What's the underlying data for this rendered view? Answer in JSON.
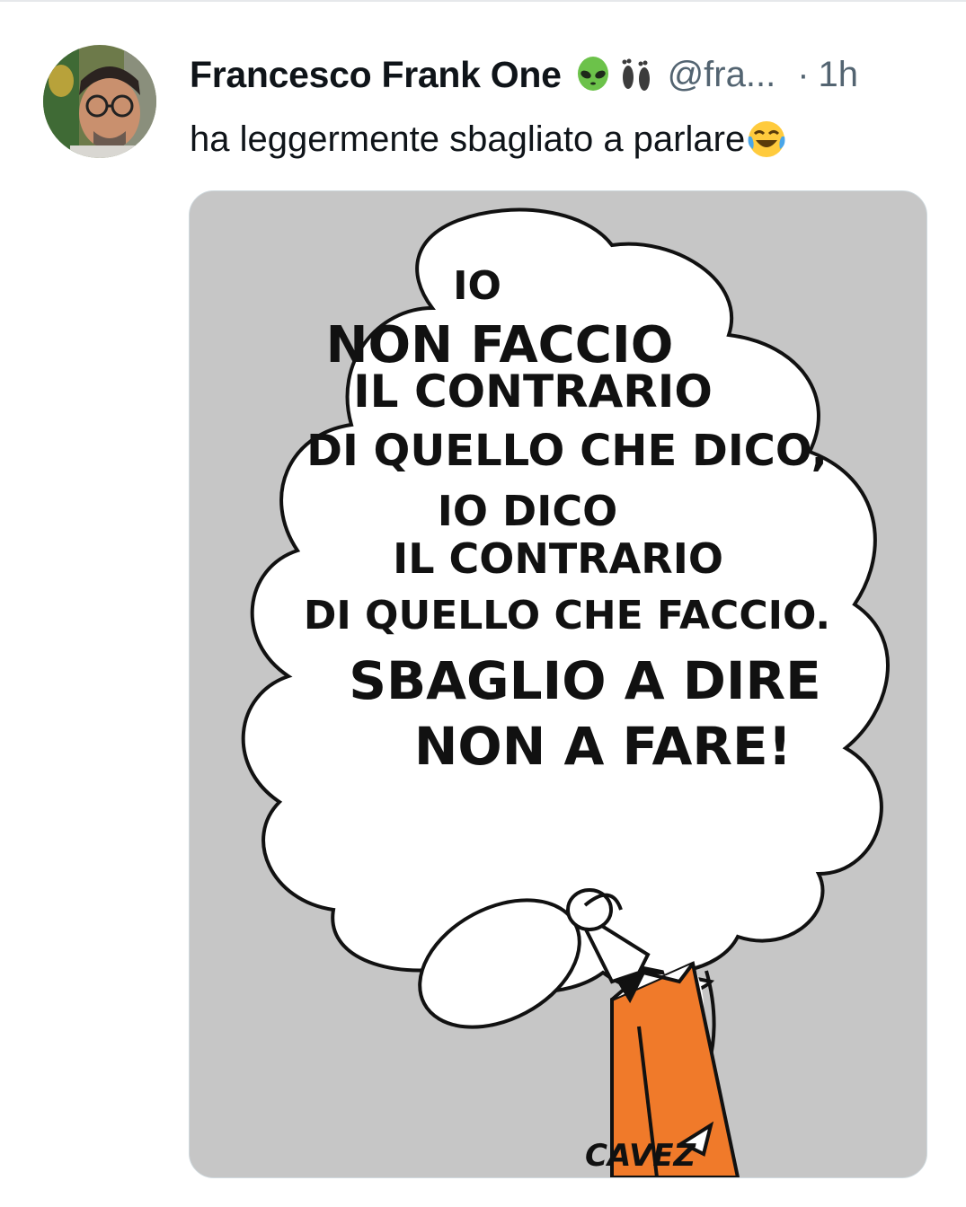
{
  "post": {
    "author_name": "Francesco Frank One",
    "author_emojis": [
      "alien-emoji",
      "footprints-emoji"
    ],
    "handle": "@fra...",
    "separator": "·",
    "time": "1h",
    "text": "ha leggermente sbagliato a parlare",
    "text_emoji": "joy-emoji"
  },
  "media": {
    "comic_lines": [
      "IO",
      "NON FACCIO",
      "IL CONTRARIO",
      "DI QUELLO CHE DICO,",
      "IO DICO",
      "IL CONTRARIO",
      "DI QUELLO CHE FACCIO.",
      "SBAGLIO A DIRE",
      "NON A FARE!"
    ],
    "signature": "CAVEZ",
    "colors": {
      "background": "#c6c6c6",
      "bubble": "#ffffff",
      "jacket": "#f07a2a"
    }
  }
}
